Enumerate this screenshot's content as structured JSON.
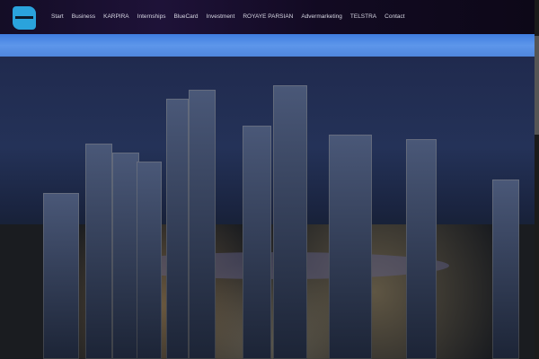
{
  "header": {
    "logo": "logo",
    "nav": [
      "Start",
      "Business",
      "KARPIRA",
      "Internships",
      "BlueCard",
      "Investment",
      "ROYAYE PARSIAN",
      "Advermarketing",
      "TELSTRA",
      "Contact"
    ]
  },
  "hero": {
    "image": "city-skyline-night"
  }
}
